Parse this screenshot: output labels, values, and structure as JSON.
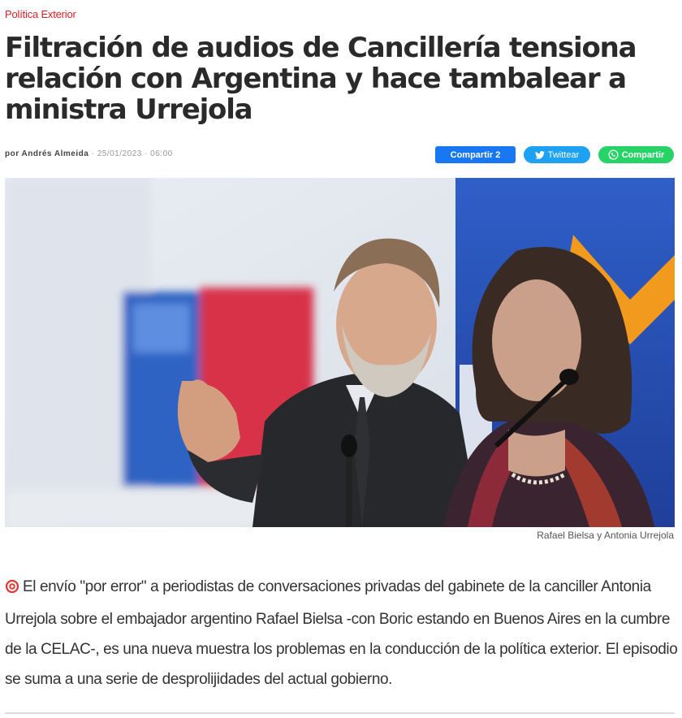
{
  "article": {
    "category": "Política Exterior",
    "headline": "Filtración de audios de Cancillería tensiona relación con Argentina y hace tambalear a ministra Urrejola",
    "byline_prefix": "por",
    "author": "Andrés Almeida",
    "separator": "-",
    "date": "25/01/2023",
    "time": "06:00",
    "image_caption": "Rafael Bielsa y Antonia Urrejola",
    "lead": "El envío \"por error\" a periodistas de conversaciones privadas del gabinete de la canciller Antonia Urrejola sobre el embajador argentino Rafael Bielsa -con Boric estando en Buenos Aires en la cumbre de la CELAC-, es una nueva muestra los problemas en la conducción de la política exterior. El episodio se suma a una serie de desprolijidades del actual gobierno."
  },
  "share": {
    "facebook_label": "Compartir 2",
    "twitter_label": "Twittear",
    "whatsapp_label": "Compartir"
  },
  "colors": {
    "category": "#d81f26",
    "facebook": "#1877f2",
    "twitter": "#1da1f2",
    "whatsapp": "#25d366"
  },
  "icons": [
    "twitter-bird-icon",
    "whatsapp-icon",
    "target-icon"
  ]
}
